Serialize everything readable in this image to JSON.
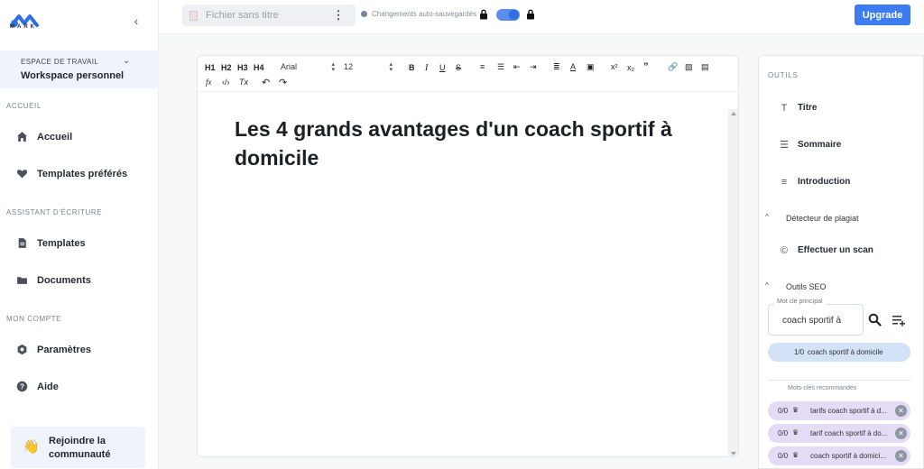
{
  "app": {
    "logo_text": "MARK",
    "collapse_icon": "chevron-left-icon"
  },
  "workspace": {
    "label": "ESPACE DE TRAVAIL",
    "name": "Workspace personnel"
  },
  "sidebar": {
    "sections": [
      {
        "title": "ACCUEIL",
        "items": [
          {
            "label": "Accueil",
            "icon": "home-icon"
          },
          {
            "label": "Templates préférés",
            "icon": "heart-icon"
          }
        ]
      },
      {
        "title": "ASSISTANT D'ÉCRITURE",
        "items": [
          {
            "label": "Templates",
            "icon": "document-icon"
          },
          {
            "label": "Documents",
            "icon": "folder-icon"
          }
        ]
      },
      {
        "title": "MON COMPTE",
        "items": [
          {
            "label": "Paramètres",
            "icon": "gear-icon"
          },
          {
            "label": "Aide",
            "icon": "help-icon"
          }
        ]
      }
    ],
    "community": {
      "label": "Rejoindre la communauté",
      "icon": "waving-hand-icon"
    }
  },
  "topbar": {
    "file_placeholder": "Fichier sans titre",
    "autosave_text": "Changements auto-sauvegardés",
    "upgrade_label": "Upgrade",
    "accent_color": "#3d7cf0"
  },
  "toolbar": {
    "headings": [
      "H1",
      "H2",
      "H3",
      "H4"
    ],
    "font": "Arial",
    "size": "12"
  },
  "document": {
    "title": "Les 4 grands avantages d'un coach sportif à domicile"
  },
  "panel": {
    "title": "OUTILS",
    "tools": [
      {
        "label": "Titre",
        "icon": "text-icon"
      },
      {
        "label": "Sommaire",
        "icon": "list-icon"
      },
      {
        "label": "Introduction",
        "icon": "paragraph-icon"
      }
    ],
    "plagiarism": {
      "header": "Détecteur de plagiat",
      "action": "Effectuer un scan"
    },
    "seo": {
      "header": "Outils SEO",
      "keyword_legend": "Mot clé principal",
      "keyword_value": "coach sportif à",
      "main_keyword": {
        "count": "1/0",
        "text": "coach sportif à domicile"
      },
      "recommended_title": "Mots-clés recommandés",
      "recommended": [
        {
          "count": "0/0",
          "text": "tarifs coach sportif à d..."
        },
        {
          "count": "0/0",
          "text": "tarif coach sportif à do..."
        },
        {
          "count": "0/0",
          "text": "coach sportif à domici..."
        }
      ]
    }
  }
}
